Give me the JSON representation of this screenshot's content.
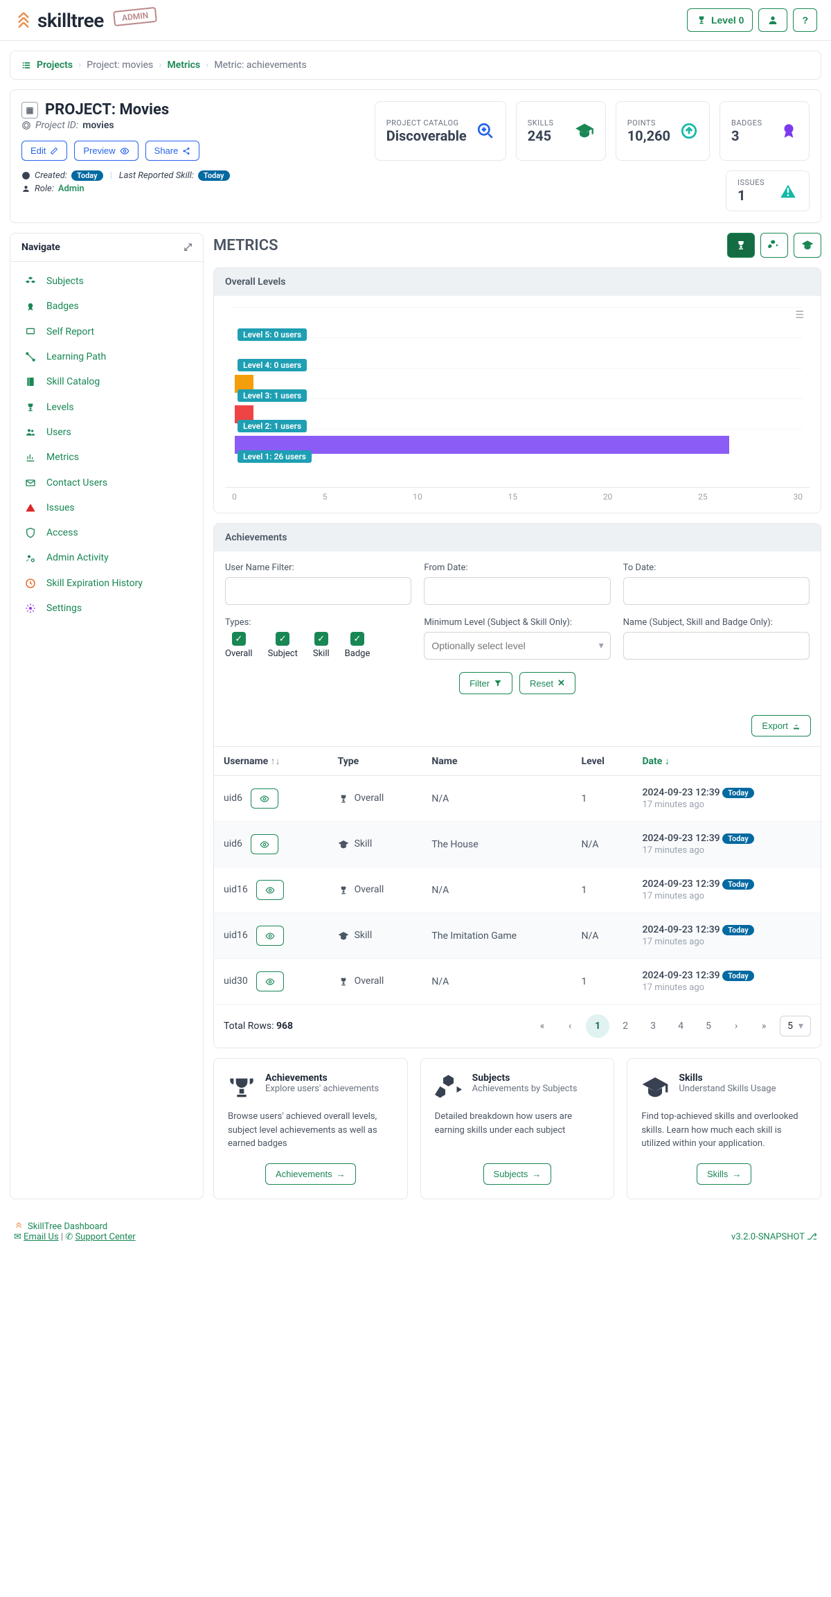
{
  "header": {
    "brand": "skilltree",
    "stamp": "ADMIN",
    "level_label": "Level 0"
  },
  "breadcrumb": {
    "projects": "Projects",
    "project": "Project: movies",
    "metrics": "Metrics",
    "current": "Metric: achievements"
  },
  "project": {
    "title": "PROJECT: Movies",
    "id_label": "Project ID:",
    "id_value": "movies",
    "buttons": {
      "edit": "Edit",
      "preview": "Preview",
      "share": "Share"
    },
    "stats": {
      "catalog_label": "PROJECT CATALOG",
      "catalog_value": "Discoverable",
      "skills_label": "SKILLS",
      "skills_value": "245",
      "points_label": "POINTS",
      "points_value": "10,260",
      "badges_label": "BADGES",
      "badges_value": "3"
    },
    "meta": {
      "created_label": "Created:",
      "created_badge": "Today",
      "lastrep_label": "Last Reported Skill:",
      "lastrep_badge": "Today",
      "role_label": "Role:",
      "role_value": "Admin"
    },
    "issues": {
      "label": "ISSUES",
      "value": "1"
    }
  },
  "sidebar": {
    "title": "Navigate",
    "items": [
      {
        "label": "Subjects",
        "icon": "cubes"
      },
      {
        "label": "Badges",
        "icon": "award"
      },
      {
        "label": "Self Report",
        "icon": "laptop"
      },
      {
        "label": "Learning Path",
        "icon": "path"
      },
      {
        "label": "Skill Catalog",
        "icon": "book"
      },
      {
        "label": "Levels",
        "icon": "trophy"
      },
      {
        "label": "Users",
        "icon": "users"
      },
      {
        "label": "Metrics",
        "icon": "chart"
      },
      {
        "label": "Contact Users",
        "icon": "mail"
      },
      {
        "label": "Issues",
        "icon": "warn"
      },
      {
        "label": "Access",
        "icon": "shield"
      },
      {
        "label": "Admin Activity",
        "icon": "usercog"
      },
      {
        "label": "Skill Expiration History",
        "icon": "clock"
      },
      {
        "label": "Settings",
        "icon": "cogs"
      }
    ]
  },
  "metrics": {
    "heading": "METRICS",
    "overall_title": "Overall Levels",
    "achievements_title": "Achievements"
  },
  "chart_data": {
    "type": "bar",
    "orientation": "horizontal",
    "title": "Overall Levels",
    "xlim": [
      0,
      30
    ],
    "xticks": [
      0,
      5,
      10,
      15,
      20,
      25,
      30
    ],
    "series": [
      {
        "name": "Level 5",
        "value": 0,
        "label": "Level 5: 0 users",
        "color": "#a855f7"
      },
      {
        "name": "Level 4",
        "value": 0,
        "label": "Level 4: 0 users",
        "color": "#eab308"
      },
      {
        "name": "Level 3",
        "value": 1,
        "label": "Level 3: 1 users",
        "color": "#f59e0b"
      },
      {
        "name": "Level 2",
        "value": 1,
        "label": "Level 2: 1 users",
        "color": "#ef4444"
      },
      {
        "name": "Level 1",
        "value": 26,
        "label": "Level 1: 26 users",
        "color": "#8b5cf6"
      }
    ]
  },
  "filters": {
    "username_label": "User Name Filter:",
    "from_label": "From Date:",
    "to_label": "To Date:",
    "types_label": "Types:",
    "types": [
      "Overall",
      "Subject",
      "Skill",
      "Badge"
    ],
    "minlevel_label": "Minimum Level (Subject & Skill Only):",
    "minlevel_placeholder": "Optionally select level",
    "name_label": "Name (Subject, Skill and Badge Only):",
    "filter_btn": "Filter",
    "reset_btn": "Reset",
    "export_btn": "Export"
  },
  "table": {
    "headers": {
      "user": "Username",
      "type": "Type",
      "name": "Name",
      "level": "Level",
      "date": "Date"
    },
    "rows": [
      {
        "user": "uid6",
        "type": "Overall",
        "type_icon": "trophy",
        "name": "N/A",
        "level": "1",
        "date": "2024-09-23 12:39",
        "badge": "Today",
        "ago": "17 minutes ago"
      },
      {
        "user": "uid6",
        "type": "Skill",
        "type_icon": "grad",
        "name": "The House",
        "level": "N/A",
        "date": "2024-09-23 12:39",
        "badge": "Today",
        "ago": "17 minutes ago"
      },
      {
        "user": "uid16",
        "type": "Overall",
        "type_icon": "trophy",
        "name": "N/A",
        "level": "1",
        "date": "2024-09-23 12:39",
        "badge": "Today",
        "ago": "17 minutes ago"
      },
      {
        "user": "uid16",
        "type": "Skill",
        "type_icon": "grad",
        "name": "The Imitation Game",
        "level": "N/A",
        "date": "2024-09-23 12:39",
        "badge": "Today",
        "ago": "17 minutes ago"
      },
      {
        "user": "uid30",
        "type": "Overall",
        "type_icon": "trophy",
        "name": "N/A",
        "level": "1",
        "date": "2024-09-23 12:39",
        "badge": "Today",
        "ago": "17 minutes ago"
      }
    ],
    "total_label": "Total Rows:",
    "total": "968",
    "pages": [
      "1",
      "2",
      "3",
      "4",
      "5"
    ],
    "page_size": "5"
  },
  "cards": [
    {
      "title": "Achievements",
      "sub": "Explore users' achievements",
      "desc": "Browse users' achieved overall levels, subject level achievements as well as earned badges",
      "btn": "Achievements",
      "icon": "trophy"
    },
    {
      "title": "Subjects",
      "sub": "Achievements by Subjects",
      "desc": "Detailed breakdown how users are earning skills under each subject",
      "btn": "Subjects",
      "icon": "cubes"
    },
    {
      "title": "Skills",
      "sub": "Understand Skills Usage",
      "desc": "Find top-achieved skills and overlooked skills. Learn how much each skill is utilized within your application.",
      "btn": "Skills",
      "icon": "grad"
    }
  ],
  "footer": {
    "title": "SkillTree Dashboard",
    "email": "Email Us",
    "support": "Support Center",
    "version": "v3.2.0-SNAPSHOT"
  }
}
